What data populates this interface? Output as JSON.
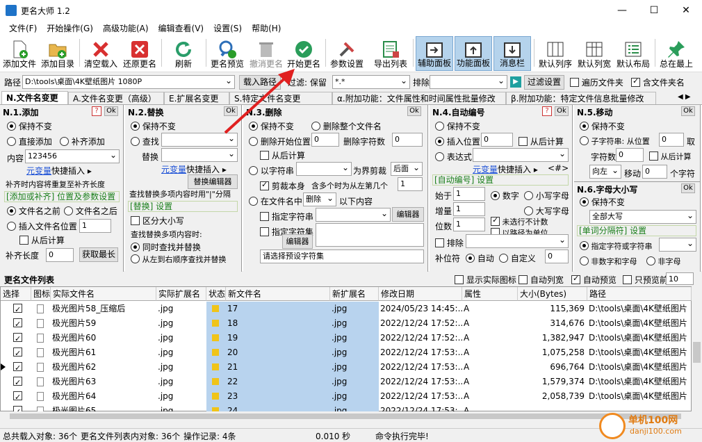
{
  "window": {
    "title": "更名大师 1.2",
    "minimize": "—",
    "maximize": "☐",
    "close": "✕"
  },
  "menu": [
    "文件(F)",
    "开始操作(G)",
    "高级功能(A)",
    "编辑查看(V)",
    "设置(S)",
    "帮助(H)"
  ],
  "toolbar": [
    {
      "label": "添加文件",
      "icon": "add-file-icon"
    },
    {
      "label": "添加目录",
      "icon": "add-folder-icon"
    },
    {
      "label": "清空载入",
      "icon": "clear-icon"
    },
    {
      "label": "还原更名",
      "icon": "restore-icon"
    },
    {
      "label": "刷新",
      "icon": "refresh-icon"
    },
    {
      "label": "更名预览",
      "icon": "preview-icon"
    },
    {
      "label": "撤消更名",
      "icon": "undo-icon"
    },
    {
      "label": "开始更名",
      "icon": "start-icon"
    },
    {
      "label": "参数设置",
      "icon": "settings-icon"
    },
    {
      "label": "导出列表",
      "icon": "export-icon"
    },
    {
      "label": "辅助面板",
      "icon": "aux-panel-icon"
    },
    {
      "label": "功能面板",
      "icon": "func-panel-icon"
    },
    {
      "label": "消息栏",
      "icon": "msg-bar-icon"
    },
    {
      "label": "默认列序",
      "icon": "col-order-icon"
    },
    {
      "label": "默认列宽",
      "icon": "col-width-icon"
    },
    {
      "label": "默认布局",
      "icon": "layout-icon"
    },
    {
      "label": "总在最上",
      "icon": "pin-icon"
    }
  ],
  "pathbar": {
    "path_label": "路径",
    "path_value": "D:\\tools\\桌面\\4K壁纸图片 1080P",
    "load_path": "载入路径",
    "filter_label": "过滤: 保留",
    "filter_value": "*.*",
    "exclude_label": "排除",
    "filter_settings": "过滤设置",
    "traverse_subfolders": "遍历文件夹",
    "include_folder_name": "含文件夹名"
  },
  "tabs": [
    "N.文件名变更",
    "A.文件名变更（高级）",
    "E.扩展名变更",
    "S.特定文件名变更",
    "α.附加功能：文件属性和时间属性批量修改",
    "β.附加功能：特定文件信息批量修改"
  ],
  "p1": {
    "title": "N.1.添加",
    "keep": "保持不变",
    "direct_add": "直接添加",
    "pad_add": "补齐添加",
    "content_label": "内容",
    "content_value": "123456",
    "var_link": "元变量",
    "quick_insert": "快捷插入 ▸",
    "note": "补齐时内容将重复至补齐长度",
    "sect": "[添加或补齐] 位置及参数设置",
    "before": "文件名之前",
    "after": "文件名之后",
    "insert_pos": "插入文件名位置",
    "insert_val": "1",
    "from_back": "从后计算",
    "pad_len_label": "补齐长度",
    "pad_len_val": "0",
    "get_max": "获取最长"
  },
  "p2": {
    "title": "N.2.替换",
    "keep": "保持不变",
    "find": "查找",
    "replace": "替换",
    "var_link": "元变量",
    "quick_insert": "快捷插入 ▸",
    "replace_editor": "替换编辑器",
    "note": "查找替换多项内容时用\"|\"分隔",
    "sect": "[替换] 设置",
    "case": "区分大小写",
    "multi_note": "查找替换多项内容时:",
    "simul": "同时查找并替换",
    "seq": "从左到右顺序查找并替换"
  },
  "p3": {
    "title": "N.3.删除",
    "keep": "保持不变",
    "del_whole": "删除整个文件名",
    "del_start": "删除开始位置",
    "start_val": "0",
    "del_count": "删除字符数",
    "count_val": "0",
    "from_back": "从后计算",
    "by_string": "以字符串",
    "as_boundary": "为界剪裁",
    "trim_after": "后面",
    "trim_self": "剪裁本身",
    "multi_from": "含多个时为从左第几个",
    "multi_val": "1",
    "in_name": "在文件名中",
    "del_mode": "删除",
    "after_content": "以下内容",
    "specific_str": "指定字符串",
    "editor": "编辑器",
    "specific_set": "指定字符集",
    "editor2": "编辑器",
    "preset_hint": "请选择预设字符集"
  },
  "p4": {
    "title": "N.4.自动编号",
    "keep": "保持不变",
    "insert_pos": "插入位置",
    "insert_val": "0",
    "from_back": "从后计算",
    "expr": "表达式",
    "var_link": "元变量",
    "quick_insert": "快捷插入 ▸",
    "expr_tag": "<#>",
    "sect": "[自动编号] 设置",
    "start_label": "始于",
    "start_val": "1",
    "num": "数字",
    "lower": "小写字母",
    "step_label": "增量",
    "step_val": "1",
    "upper": "大写字母",
    "digits_label": "位数",
    "digits_val": "1",
    "no_count_unselected": "未选行不计数",
    "path_unit": "以路径为单位",
    "exclude": "排除",
    "pad_label": "补位符",
    "auto": "自动",
    "custom": "自定义",
    "custom_val": "0"
  },
  "p5": {
    "title": "N.5.移动",
    "keep": "保持不变",
    "substr": "子字符串: 从位置",
    "pos_val": "0",
    "take": "取",
    "char_count": "字符数",
    "count_val": "0",
    "from_back": "从后计算",
    "direction": "向左",
    "move": "移动",
    "move_val": "0",
    "chars": "个字符"
  },
  "p6": {
    "title": "N.6.字母大小写",
    "keep": "保持不变",
    "mode": "全部大写",
    "sect": "[单词分隔符] 设置",
    "spec_char": "指定字符或字符串",
    "non_num": "非数字和字母",
    "non_char": "非字母"
  },
  "list": {
    "title": "更名文件列表",
    "show_icons": "显示实际图标",
    "auto_col_width": "自动列宽",
    "auto_preview": "自动预览",
    "preview_only": "只预览前",
    "preview_n": "10"
  },
  "columns": [
    "选择",
    "图标",
    "实际文件名",
    "实际扩展名",
    "状态",
    "新文件名",
    "新扩展名",
    "修改日期",
    "属性",
    "大小(Bytes)",
    "路径"
  ],
  "rows": [
    {
      "name": "极光图片58_压缩后",
      "ext": ".jpg",
      "new": "17",
      "newext": ".jpg",
      "date": "2024/05/23 14:45:..",
      "attr": "A",
      "size": "115,369",
      "path": "D:\\tools\\桌面\\4K壁纸图片"
    },
    {
      "name": "极光图片59",
      "ext": ".jpg",
      "new": "18",
      "newext": ".jpg",
      "date": "2022/12/24 17:52:..",
      "attr": "A",
      "size": "314,676",
      "path": "D:\\tools\\桌面\\4K壁纸图片"
    },
    {
      "name": "极光图片60",
      "ext": ".jpg",
      "new": "19",
      "newext": ".jpg",
      "date": "2022/12/24 17:52:..",
      "attr": "A",
      "size": "1,382,947",
      "path": "D:\\tools\\桌面\\4K壁纸图片"
    },
    {
      "name": "极光图片61",
      "ext": ".jpg",
      "new": "20",
      "newext": ".jpg",
      "date": "2022/12/24 17:53:..",
      "attr": "A",
      "size": "1,075,258",
      "path": "D:\\tools\\桌面\\4K壁纸图片"
    },
    {
      "name": "极光图片62",
      "ext": ".jpg",
      "new": "21",
      "newext": ".jpg",
      "date": "2022/12/24 17:53:..",
      "attr": "A",
      "size": "696,764",
      "path": "D:\\tools\\桌面\\4K壁纸图片"
    },
    {
      "name": "极光图片63",
      "ext": ".jpg",
      "new": "22",
      "newext": ".jpg",
      "date": "2022/12/24 17:53:..",
      "attr": "A",
      "size": "1,579,374",
      "path": "D:\\tools\\桌面\\4K壁纸图片"
    },
    {
      "name": "极光图片64",
      "ext": ".jpg",
      "new": "23",
      "newext": ".jpg",
      "date": "2022/12/24 17:53:..",
      "attr": "A",
      "size": "2,058,739",
      "path": "D:\\tools\\桌面\\4K壁纸图片"
    },
    {
      "name": "极光图片65",
      "ext": ".jpg",
      "new": "24",
      "newext": ".jpg",
      "date": "2022/12/24 17:53:..",
      "attr": "A",
      "size": "",
      "path": ""
    }
  ],
  "status": {
    "total": "总共载入对象: 36个",
    "in_list": "更名文件列表内对象: 36个",
    "ops": "操作记录: 4条",
    "time": "0.010 秒",
    "msg": "命令执行完毕!"
  },
  "watermark": {
    "text": "单机100网",
    "url": "danji100.com"
  },
  "colors": {
    "accent": "#1a7f1a",
    "selected": "#b8d3ee",
    "arrow": "#e02020"
  }
}
